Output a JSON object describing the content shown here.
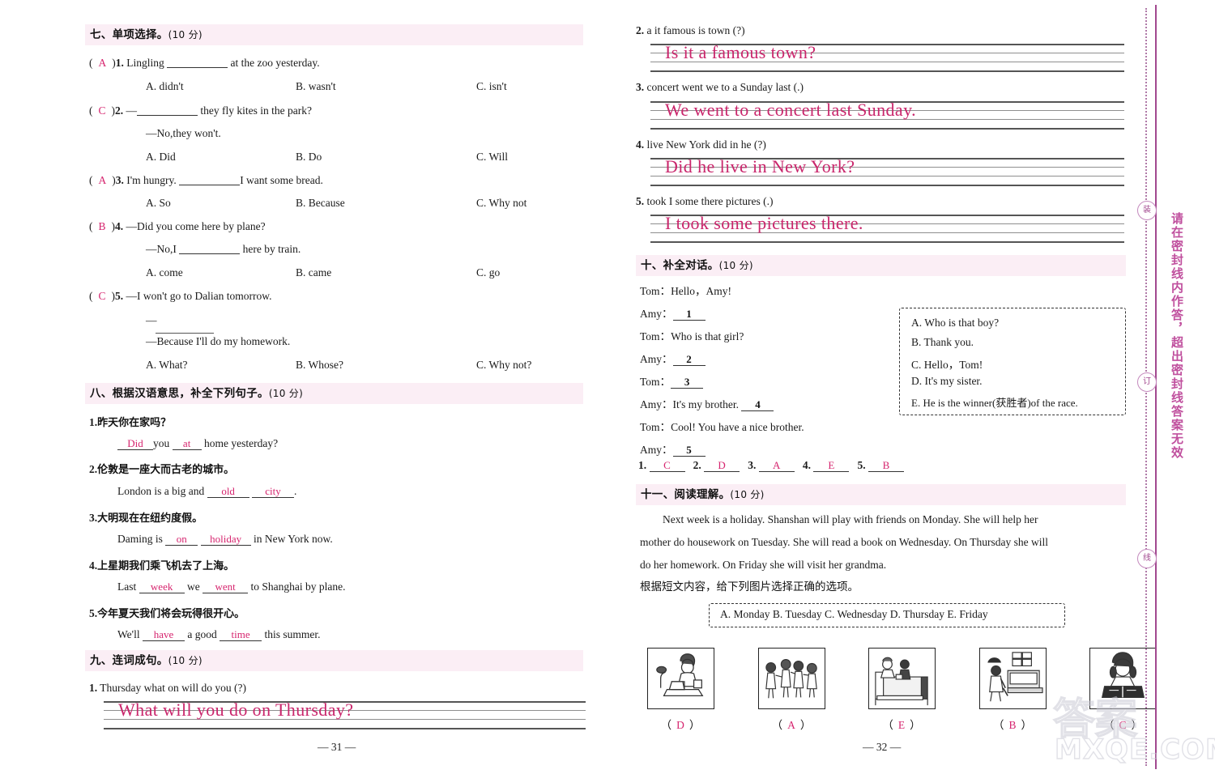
{
  "left_page": {
    "page_number": "— 31 —",
    "section7": {
      "heading": "七、单项选择。",
      "points": "(10 分)",
      "questions": [
        {
          "answer": "A",
          "num": "1.",
          "stem_before": "Lingling",
          "stem_after": "at the zoo yesterday.",
          "options": [
            "A. didn't",
            "B. wasn't",
            "C. isn't"
          ]
        },
        {
          "answer": "C",
          "num": "2.",
          "stem_before": "—",
          "stem_after": "they fly kites in the park?",
          "stem_line2": "—No,they won't.",
          "options": [
            "A. Did",
            "B. Do",
            "C. Will"
          ]
        },
        {
          "answer": "A",
          "num": "3.",
          "stem_before": "I'm hungry.",
          "stem_after": "I want some bread.",
          "options": [
            "A. So",
            "B. Because",
            "C. Why not"
          ]
        },
        {
          "answer": "B",
          "num": "4.",
          "stem_before": "—Did you come here by plane?",
          "stem_after": "",
          "stem_line2_before": "—No,I",
          "stem_line2_after": "here by train.",
          "options": [
            "A. come",
            "B. came",
            "C. go"
          ]
        },
        {
          "answer": "C",
          "num": "5.",
          "stem_before": "—I won't go to Dalian tomorrow.",
          "stem_after": "",
          "stem_line2_before": "—",
          "stem_line3": "—Because I'll do my homework.",
          "options": [
            "A. What?",
            "B. Whose?",
            "C. Why not?"
          ]
        }
      ]
    },
    "section8": {
      "heading": "八、根据汉语意思，补全下列句子。",
      "points": "(10 分)",
      "items": [
        {
          "num": "1.",
          "chinese": "昨天你在家吗？",
          "parts": [
            "",
            "Did",
            "you",
            "at",
            "home yesterday?"
          ],
          "answers": [
            "Did",
            "at"
          ]
        },
        {
          "num": "2.",
          "chinese": "伦敦是一座大而古老的城市。",
          "parts": [
            "London is a big and",
            "old",
            "",
            "city",
            "."
          ],
          "answers": [
            "old",
            "city"
          ]
        },
        {
          "num": "3.",
          "chinese": "大明现在在纽约度假。",
          "parts": [
            "Daming is",
            "on",
            "",
            "holiday",
            "in New York now."
          ],
          "answers": [
            "on",
            "holiday"
          ]
        },
        {
          "num": "4.",
          "chinese": "上星期我们乘飞机去了上海。",
          "parts": [
            "Last",
            "week",
            "we",
            "went",
            "to Shanghai by plane."
          ],
          "answers": [
            "week",
            "went"
          ]
        },
        {
          "num": "5.",
          "chinese": "今年夏天我们将会玩得很开心。",
          "parts": [
            "We'll",
            "have",
            "a good",
            "time",
            "this summer."
          ],
          "answers": [
            "have",
            "time"
          ]
        }
      ]
    },
    "section9": {
      "heading": "九、连词成句。",
      "points": "(10 分)",
      "items": [
        {
          "num": "1.",
          "words": "Thursday   what   on   will   do   you   (?)",
          "answer": "What will you do on Thursday?"
        }
      ]
    }
  },
  "right_page": {
    "page_number": "— 32 —",
    "section9_cont": {
      "items": [
        {
          "num": "2.",
          "words": "a   it   famous   is   town   (?)",
          "answer": "Is it a famous town?"
        },
        {
          "num": "3.",
          "words": "concert   went   we   to   a   Sunday   last   (.)",
          "answer": "We went to a concert last Sunday."
        },
        {
          "num": "4.",
          "words": "live   New York   did   in   he   (?)",
          "answer": "Did he live in New York?"
        },
        {
          "num": "5.",
          "words": "took   I   some   there   pictures   (.)",
          "answer": "I took some pictures there."
        }
      ]
    },
    "section10": {
      "heading": "十、补全对话。",
      "points": "(10 分)",
      "dialogue": [
        {
          "speaker": "Tom：",
          "text": "Hello，Amy!",
          "blank": ""
        },
        {
          "speaker": "Amy：",
          "text": "",
          "blank": "1"
        },
        {
          "speaker": "Tom：",
          "text": "Who is that girl?",
          "blank": ""
        },
        {
          "speaker": "Amy：",
          "text": "",
          "blank": "2"
        },
        {
          "speaker": "Tom：",
          "text": "",
          "blank": "3"
        },
        {
          "speaker": "Amy：",
          "text": "It's my brother.",
          "blank": "4"
        },
        {
          "speaker": "Tom：",
          "text": "Cool!  You have a nice brother.",
          "blank": ""
        },
        {
          "speaker": "Amy：",
          "text": "",
          "blank": "5"
        }
      ],
      "choices": [
        "A. Who is that boy?",
        "B. Thank you.",
        "C. Hello，Tom!",
        "D. It's my sister.",
        "E. He is the winner(获胜者)of the race."
      ],
      "answers": [
        {
          "num": "1.",
          "value": "C"
        },
        {
          "num": "2.",
          "value": "D"
        },
        {
          "num": "3.",
          "value": "A"
        },
        {
          "num": "4.",
          "value": "E"
        },
        {
          "num": "5.",
          "value": "B"
        }
      ]
    },
    "section11": {
      "heading": "十一、阅读理解。",
      "points": "(10 分)",
      "passage": [
        "Next  week  is  a  holiday. Shanshan  will  play  with  friends  on  Monday. She  will  help  her",
        "mother do housework on Tuesday. She will read a book on Wednesday. On Thursday she will",
        "do her homework. On Friday she will visit her grandma."
      ],
      "instruction": "根据短文内容，给下列图片选择正确的选项。",
      "option_bar": "A. Monday   B. Tuesday   C. Wednesday   D. Thursday   E. Friday",
      "pictures": [
        {
          "icon": "girl-doing-homework-at-desk-icon",
          "answer": "D"
        },
        {
          "icon": "children-playing-together-icon",
          "answer": "A"
        },
        {
          "icon": "visiting-grandma-in-bed-icon",
          "answer": "E"
        },
        {
          "icon": "mother-and-child-housework-icon",
          "answer": "B"
        },
        {
          "icon": "girl-reading-book-icon",
          "answer": "C"
        }
      ]
    }
  },
  "seal_line": {
    "vertical_text": "请在密封线内作答，超出密封线答案无效",
    "markers": [
      "装",
      "订",
      "线"
    ]
  },
  "watermark": {
    "line1": "答案",
    "line2": "MXQE.COM"
  },
  "colors": {
    "header_bg": "#fbeef5",
    "answer_pink": "#d6246e",
    "hand_pink": "#c9256b",
    "seal_purple": "#a2488f"
  }
}
